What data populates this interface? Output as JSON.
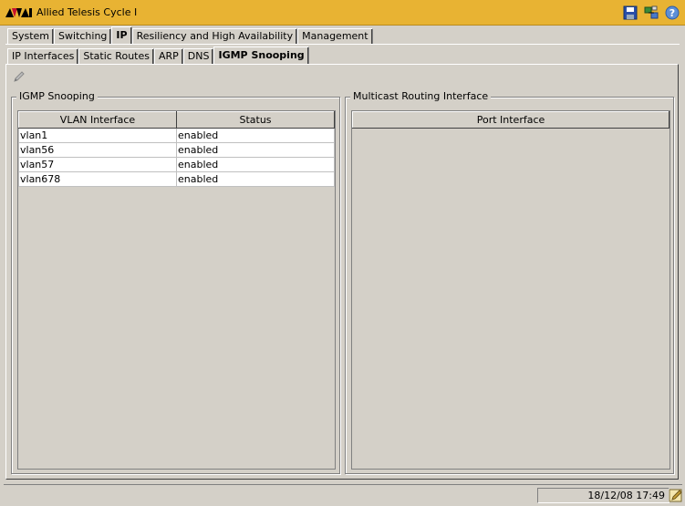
{
  "app": {
    "title": "Allied Telesis Cycle I"
  },
  "title_icons": [
    "save-icon",
    "network-config-icon",
    "help-icon"
  ],
  "colors": {
    "titlebar": "#e8b333",
    "logo_red": "#c8102e",
    "window_bg": "#d4d0c8"
  },
  "main_tabs": [
    {
      "label": "System",
      "active": false
    },
    {
      "label": "Switching",
      "active": false
    },
    {
      "label": "IP",
      "active": true
    },
    {
      "label": "Resiliency and High Availability",
      "active": false
    },
    {
      "label": "Management",
      "active": false
    }
  ],
  "sub_tabs": [
    {
      "label": "IP Interfaces",
      "active": false
    },
    {
      "label": "Static Routes",
      "active": false
    },
    {
      "label": "ARP",
      "active": false
    },
    {
      "label": "DNS",
      "active": false
    },
    {
      "label": "IGMP Snooping",
      "active": true
    }
  ],
  "igmp_group": {
    "label": "IGMP Snooping",
    "columns": [
      "VLAN Interface",
      "Status"
    ],
    "rows": [
      [
        "vlan1",
        "enabled"
      ],
      [
        "vlan56",
        "enabled"
      ],
      [
        "vlan57",
        "enabled"
      ],
      [
        "vlan678",
        "enabled"
      ]
    ]
  },
  "multicast_group": {
    "label": "Multicast Routing Interface",
    "columns": [
      "Port Interface"
    ]
  },
  "status": {
    "datetime": "18/12/08 17:49"
  }
}
